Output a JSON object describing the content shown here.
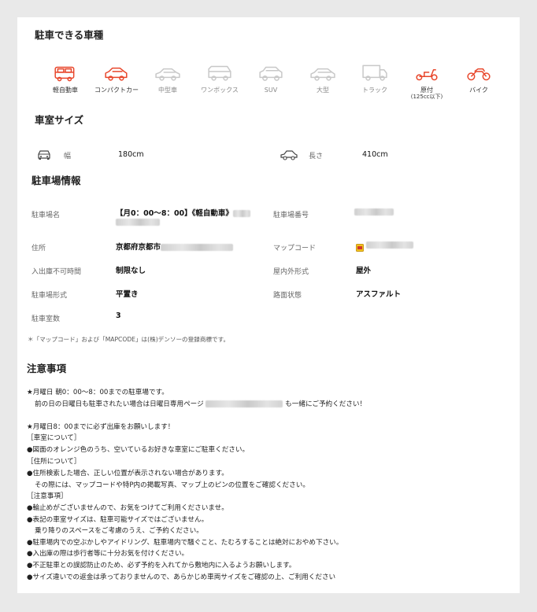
{
  "vehicle_types": {
    "title": "駐車できる車種",
    "items": [
      {
        "label": "軽自動車",
        "sub": "",
        "available": true,
        "icon": "kei-car-icon"
      },
      {
        "label": "コンパクトカー",
        "sub": "",
        "available": true,
        "icon": "compact-car-icon"
      },
      {
        "label": "中型車",
        "sub": "",
        "available": false,
        "icon": "mid-size-car-icon"
      },
      {
        "label": "ワンボックス",
        "sub": "",
        "available": false,
        "icon": "minivan-icon"
      },
      {
        "label": "SUV",
        "sub": "",
        "available": false,
        "icon": "suv-icon"
      },
      {
        "label": "大型",
        "sub": "",
        "available": false,
        "icon": "large-car-icon"
      },
      {
        "label": "トラック",
        "sub": "",
        "available": false,
        "icon": "truck-icon"
      },
      {
        "label": "原付",
        "sub": "(125cc以下)",
        "available": true,
        "icon": "scooter-icon"
      },
      {
        "label": "バイク",
        "sub": "",
        "available": true,
        "icon": "motorcycle-icon"
      }
    ],
    "accent_color": "#e8462b",
    "disabled_color": "#c8c8c8"
  },
  "room_size": {
    "title": "車室サイズ",
    "width_label": "幅",
    "width_value": "180cm",
    "length_label": "長さ",
    "length_value": "410cm"
  },
  "lot_info": {
    "title": "駐車場情報",
    "name_label": "駐車場名",
    "name_value": "【月0：00〜8：00】《軽自動車》",
    "number_label": "駐車場番号",
    "address_label": "住所",
    "address_value": "京都府京都市",
    "mapcode_label": "マップコード",
    "height_label": "入出庫不可時間",
    "height_value": "制限なし",
    "indoor_label": "屋内外形式",
    "indoor_value": "屋外",
    "type_label": "駐車場形式",
    "type_value": "平置き",
    "surface_label": "路面状態",
    "surface_value": "アスファルト",
    "count_label": "駐車室数",
    "count_value": "3",
    "footnote": "＊「マップコード」および「MAPCODE」は(株)デンソーの登録商標です。"
  },
  "notices": {
    "title": "注意事項",
    "lines": [
      "★月曜日 朝0：00〜8：00までの駐車場です。",
      "前の日の日曜日も駐車されたい場合は日曜日専用ページ",
      "も一緒にご予約ください！",
      "★月曜日8：00までに必ず出庫をお願いします！",
      "［車室について］",
      "●図面のオレンジ色のうち、空いているお好きな車室にご駐車ください。",
      "［住所について］",
      "●住所検索した場合、正しい位置が表示されない場合があります。",
      "その際には、マップコードや特P内の掲載写真、マップ上のピンの位置をご確認ください。",
      "［注意事項］",
      "●輪止めがございませんので、お気をつけてご利用くださいませ。",
      "●表記の車室サイズは、駐車可能サイズではございません。",
      "乗り降りのスペースをご考慮のうえ、ご予約ください。",
      "●駐車場内での空ぶかしやアイドリング、駐車場内で騒ぐこと、たむろすることは絶対におやめ下さい。",
      "●入出庫の際は歩行者等に十分お気を付けください。",
      "●不正駐車との誤認防止のため、必ず予約を入れてから敷地内に入るようお願いします。",
      "●サイズ違いでの返金は承っておりませんので、あらかじめ車両サイズをご確認の上、ご利用ください"
    ]
  }
}
